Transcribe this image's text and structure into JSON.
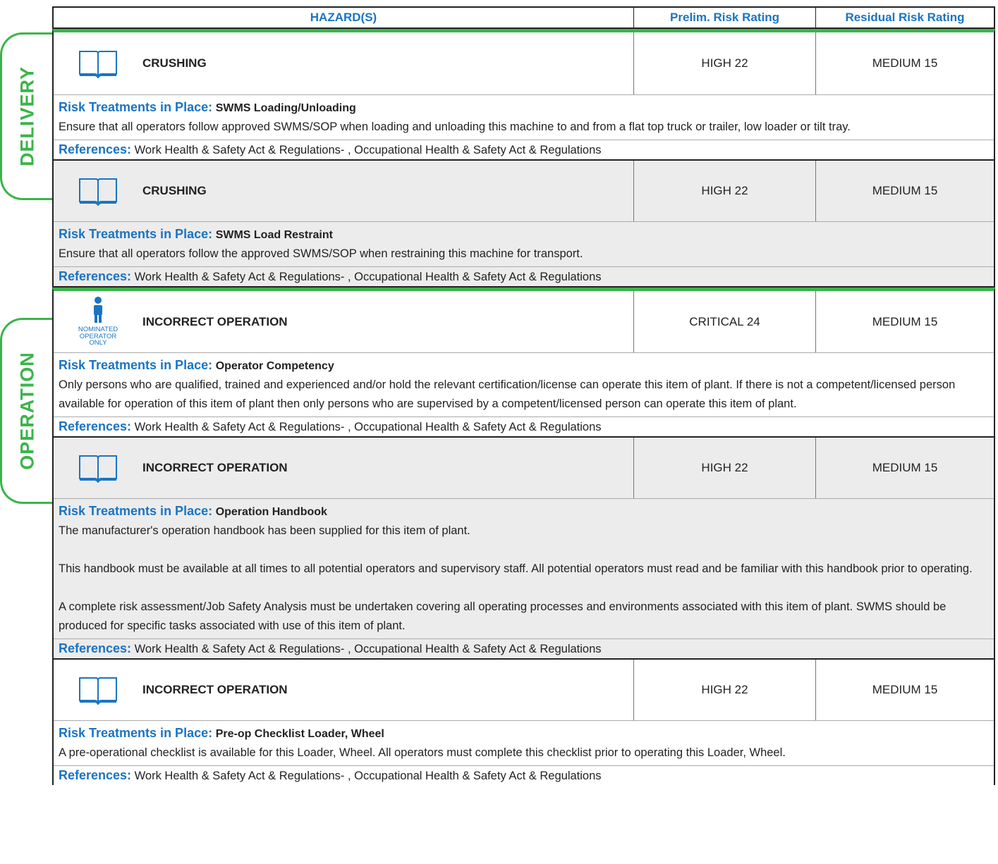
{
  "header": {
    "hazards": "HAZARD(S)",
    "prelim": "Prelim. Risk Rating",
    "residual": "Residual Risk Rating"
  },
  "sections": {
    "delivery": "DELIVERY",
    "operation": "OPERATION"
  },
  "labels": {
    "risk_treatments": "Risk Treatments in Place:",
    "references": "References:"
  },
  "colors": {
    "accent_blue": "#1a74c2",
    "section_green": "#3ab54a",
    "alt_row": "#ececec"
  },
  "rows": [
    {
      "icon": "book-icon",
      "hazard": "CRUSHING",
      "prelim": "HIGH 22",
      "residual": "MEDIUM 15",
      "treatment_name": "SWMS Loading/Unloading",
      "treatment_text": [
        "Ensure that all operators follow approved SWMS/SOP when loading and unloading this machine to and from a flat top truck or trailer, low loader or tilt tray."
      ],
      "references": "Work Health & Safety Act & Regulations- , Occupational Health & Safety Act & Regulations"
    },
    {
      "icon": "book-icon",
      "hazard": "CRUSHING",
      "prelim": "HIGH 22",
      "residual": "MEDIUM 15",
      "treatment_name": "SWMS Load Restraint",
      "treatment_text": [
        "Ensure that all operators follow the approved SWMS/SOP when restraining this machine for transport."
      ],
      "references": "Work Health & Safety Act & Regulations- , Occupational Health & Safety Act & Regulations"
    },
    {
      "icon": "nominated-operator-icon",
      "icon_text": "NOMINATED OPERATOR ONLY",
      "hazard": "INCORRECT OPERATION",
      "prelim": "CRITICAL 24",
      "residual": "MEDIUM 15",
      "treatment_name": "Operator Competency",
      "treatment_text": [
        "Only persons who are qualified, trained and experienced and/or hold the relevant certification/license can operate this item of plant. If there is not a competent/licensed person available for operation of this item of plant then only persons who are supervised by a competent/licensed person can operate this item of plant."
      ],
      "references": "Work Health & Safety Act & Regulations- , Occupational Health & Safety Act & Regulations"
    },
    {
      "icon": "book-icon",
      "hazard": "INCORRECT OPERATION",
      "prelim": "HIGH 22",
      "residual": "MEDIUM 15",
      "treatment_name": "Operation Handbook",
      "treatment_text": [
        "The manufacturer's operation handbook has been supplied for this item of plant.",
        "This handbook must be available at all times to all potential operators and supervisory staff. All potential operators must read and be familiar with this handbook prior to operating.",
        "A complete risk assessment/Job Safety Analysis must be undertaken covering all operating processes and environments associated with this item of plant. SWMS should be produced for specific tasks associated with use of this item of plant."
      ],
      "references": "Work Health & Safety Act & Regulations- , Occupational Health & Safety Act & Regulations"
    },
    {
      "icon": "book-icon",
      "hazard": "INCORRECT OPERATION",
      "prelim": "HIGH 22",
      "residual": "MEDIUM 15",
      "treatment_name": "Pre-op Checklist Loader, Wheel",
      "treatment_text": [
        "A pre-operational checklist is available for this Loader, Wheel. All operators must complete this checklist prior to operating this Loader, Wheel."
      ],
      "references": "Work Health & Safety Act & Regulations- , Occupational Health & Safety Act & Regulations"
    }
  ]
}
